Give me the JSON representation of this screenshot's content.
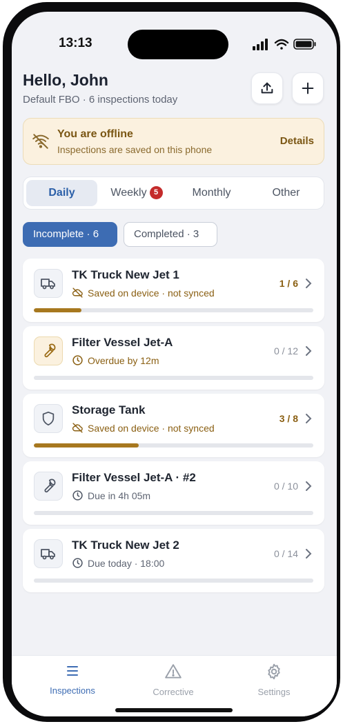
{
  "status_bar": {
    "time": "13:13"
  },
  "header": {
    "greeting": "Hello, John",
    "subtitle": "Default FBO · 6 inspections today"
  },
  "offline_banner": {
    "title": "You are offline",
    "message": "Inspections are saved on this phone",
    "action": "Details"
  },
  "tabs": [
    {
      "label": "Daily",
      "active": true
    },
    {
      "label": "Weekly",
      "badge": "5"
    },
    {
      "label": "Monthly"
    },
    {
      "label": "Other"
    }
  ],
  "filters": [
    {
      "label": "Incomplete · 6",
      "active": true
    },
    {
      "label": "Completed · 3",
      "active": false
    }
  ],
  "inspections": [
    {
      "title": "TK Truck New Jet 1",
      "status": "Saved on device · not synced",
      "status_icon": "cloud-off-icon",
      "count": "1 / 6",
      "progress": 0.17,
      "icon": "truck-icon",
      "tone": "warn"
    },
    {
      "title": "Filter Vessel Jet-A",
      "status": "Overdue by 12m",
      "status_icon": "clock-icon",
      "count": "0 / 12",
      "progress": 0,
      "icon": "wrench-icon",
      "tone": "overdue"
    },
    {
      "title": "Storage Tank",
      "status": "Saved on device · not synced",
      "status_icon": "cloud-off-icon",
      "count": "3 / 8",
      "progress": 0.375,
      "icon": "shield-icon",
      "tone": "warn"
    },
    {
      "title": "Filter Vessel Jet-A · #2",
      "status": "Due in 4h 05m",
      "status_icon": "clock-icon",
      "count": "0 / 10",
      "progress": 0,
      "icon": "wrench-icon",
      "tone": "normal"
    },
    {
      "title": "TK Truck New Jet 2",
      "status": "Due today · 18:00",
      "status_icon": "clock-icon",
      "count": "0 / 14",
      "progress": 0,
      "icon": "truck-icon",
      "tone": "normal"
    }
  ],
  "bottom_nav": [
    {
      "label": "Inspections",
      "icon": "list-icon",
      "active": true
    },
    {
      "label": "Corrective",
      "icon": "warning-triangle-icon",
      "active": false
    },
    {
      "label": "Settings",
      "icon": "gear-icon",
      "active": false
    }
  ],
  "colors": {
    "accent": "#3d6cb3",
    "warning": "#a7781f",
    "badge": "#c42b2b"
  }
}
